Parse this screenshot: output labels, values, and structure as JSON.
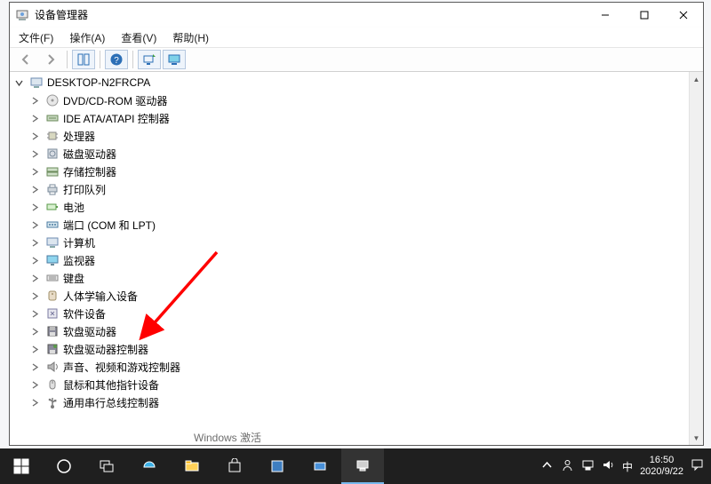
{
  "window": {
    "title": "设备管理器",
    "controls": {
      "min": "—",
      "max": "☐",
      "close": "✕"
    }
  },
  "menu": {
    "file": "文件(F)",
    "action": "操作(A)",
    "view": "查看(V)",
    "help": "帮助(H)"
  },
  "tree": {
    "root": "DESKTOP-N2FRCPA",
    "items": [
      {
        "label": "DVD/CD-ROM 驱动器",
        "icon": "cd"
      },
      {
        "label": "IDE ATA/ATAPI 控制器",
        "icon": "ide"
      },
      {
        "label": "处理器",
        "icon": "cpu"
      },
      {
        "label": "磁盘驱动器",
        "icon": "disk"
      },
      {
        "label": "存储控制器",
        "icon": "storage"
      },
      {
        "label": "打印队列",
        "icon": "printer"
      },
      {
        "label": "电池",
        "icon": "battery"
      },
      {
        "label": "端口 (COM 和 LPT)",
        "icon": "port"
      },
      {
        "label": "计算机",
        "icon": "pc"
      },
      {
        "label": "监视器",
        "icon": "monitor"
      },
      {
        "label": "键盘",
        "icon": "keyboard"
      },
      {
        "label": "人体学输入设备",
        "icon": "hid"
      },
      {
        "label": "软件设备",
        "icon": "sw"
      },
      {
        "label": "软盘驱动器",
        "icon": "floppy"
      },
      {
        "label": "软盘驱动器控制器",
        "icon": "floppyctl"
      },
      {
        "label": "声音、视频和游戏控制器",
        "icon": "audio"
      },
      {
        "label": "鼠标和其他指针设备",
        "icon": "mouse"
      },
      {
        "label": "通用串行总线控制器",
        "icon": "usb"
      }
    ]
  },
  "taskbar": {
    "ime": "中",
    "time": "16:50",
    "date": "2020/9/22"
  },
  "watermark": "Windows 激活"
}
